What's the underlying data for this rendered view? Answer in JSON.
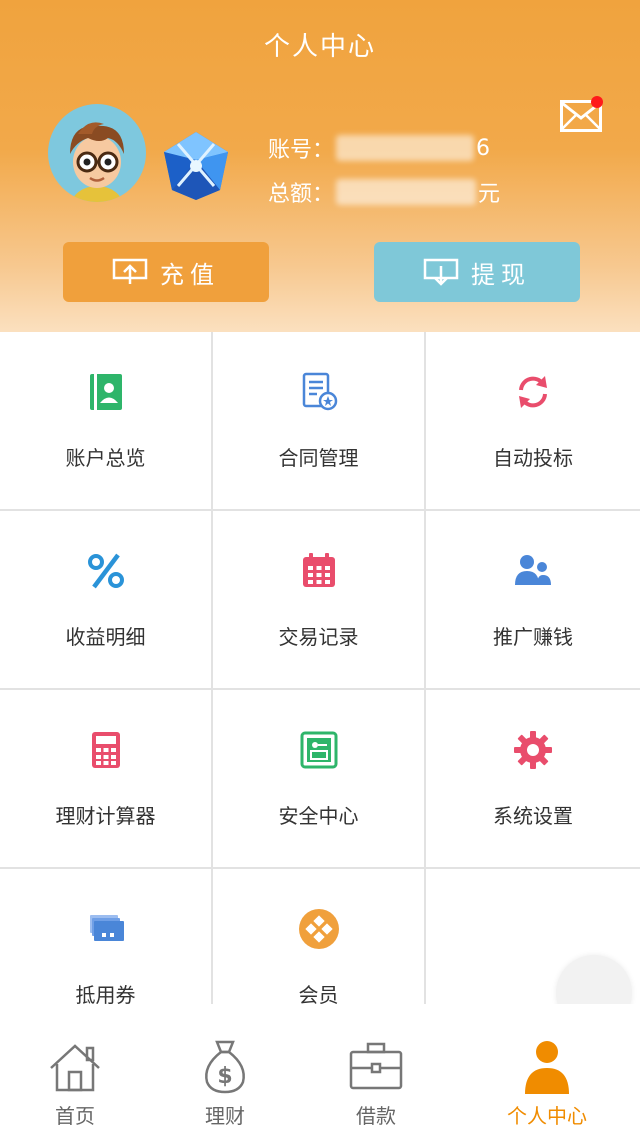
{
  "header": {
    "title": "个人中心",
    "account_label": "账号：",
    "account_suffix": "6",
    "total_label": "总额：",
    "total_suffix": "元",
    "recharge_label": "充值",
    "withdraw_label": "提现"
  },
  "menu": [
    {
      "label": "账户总览",
      "icon": "account-book-icon",
      "color": "#2eb56a"
    },
    {
      "label": "合同管理",
      "icon": "contract-icon",
      "color": "#4a86d8"
    },
    {
      "label": "自动投标",
      "icon": "refresh-icon",
      "color": "#e94d6c"
    },
    {
      "label": "收益明细",
      "icon": "percent-icon",
      "color": "#2a93d8"
    },
    {
      "label": "交易记录",
      "icon": "calendar-icon",
      "color": "#e94d6c"
    },
    {
      "label": "推广赚钱",
      "icon": "users-icon",
      "color": "#4a86d8"
    },
    {
      "label": "理财计算器",
      "icon": "calculator-icon",
      "color": "#e94d6c"
    },
    {
      "label": "安全中心",
      "icon": "safe-icon",
      "color": "#2eb56a"
    },
    {
      "label": "系统设置",
      "icon": "gear-icon",
      "color": "#e94d6c"
    },
    {
      "label": "抵用券",
      "icon": "coupon-icon",
      "color": "#4a86d8"
    },
    {
      "label": "会员",
      "icon": "member-icon",
      "color": "#f0a03c"
    }
  ],
  "tabs": [
    {
      "label": "首页",
      "icon": "home-icon"
    },
    {
      "label": "理财",
      "icon": "money-bag-icon"
    },
    {
      "label": "借款",
      "icon": "briefcase-icon"
    },
    {
      "label": "个人中心",
      "icon": "person-icon",
      "active": true
    }
  ],
  "colors": {
    "accent": "#f0a03c",
    "withdraw": "#7fc8d8",
    "active_tab": "#f08c00"
  }
}
